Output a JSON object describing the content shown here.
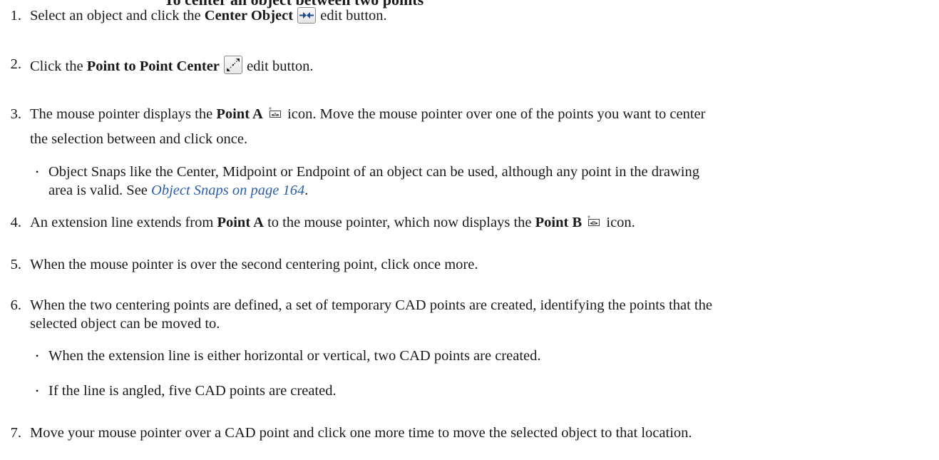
{
  "heading": {
    "text": "To center an object between two points"
  },
  "steps": [
    {
      "number": "1.",
      "parts": {
        "pre": "Select an object and click the ",
        "bold": "Center Object",
        "post": " edit button."
      },
      "icon": "center-object-icon"
    },
    {
      "number": "2.",
      "parts": {
        "pre": "Click the ",
        "bold": "Point to Point Center",
        "post": " edit button."
      },
      "icon": "point-to-point-center-icon"
    },
    {
      "number": "3.",
      "parts": {
        "pre": "The mouse pointer displays the ",
        "bold": "Point A",
        "post": " icon. Move the mouse pointer over one of the points you want to center",
        "line2": "the selection between and click once."
      },
      "icon": "point-a-cursor-icon",
      "bullet": {
        "line1": "Object Snaps like the Center, Midpoint or Endpoint of an object can be used, although any point in the drawing",
        "line2_pre": "area is valid. See ",
        "link": "Object Snaps on page 164",
        "line2_post": "."
      }
    },
    {
      "number": "4.",
      "parts": {
        "pre": "An extension line extends from ",
        "bold": "Point A",
        "mid": " to the mouse pointer, which now displays the ",
        "bold2": "Point B",
        "post": " icon."
      },
      "icon": "point-b-cursor-icon"
    },
    {
      "number": "5.",
      "text": "When the mouse pointer is over the second centering point, click once more."
    },
    {
      "number": "6.",
      "line1": "When the two centering points are defined, a set of temporary CAD points are created, identifying the points that the",
      "line2": "selected object can be moved to.",
      "bullets": [
        "When the extension line is either horizontal or vertical, two CAD points are created.",
        "If the line is angled, five CAD points are created."
      ]
    },
    {
      "number": "7.",
      "text": "Move your mouse pointer over a CAD point and click one more time to move the selected object to that location."
    }
  ],
  "bullet_glyph": "•",
  "colors": {
    "text": "#1a1a1a",
    "link": "#2b5fa8",
    "icon_blue": "#1f4e8c"
  }
}
